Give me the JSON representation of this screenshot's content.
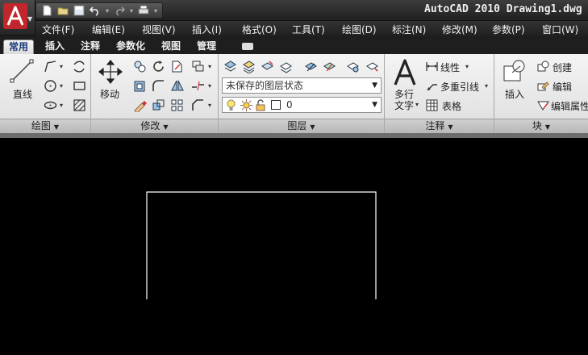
{
  "title_bar": {
    "text": "AutoCAD 2010  Drawing1.dwg"
  },
  "menu": [
    {
      "label": "文件(F)",
      "key": "file"
    },
    {
      "label": "编辑(E)",
      "key": "edit"
    },
    {
      "label": "视图(V)",
      "key": "view"
    },
    {
      "label": "插入(I)",
      "key": "insert"
    },
    {
      "label": "格式(O)",
      "key": "format"
    },
    {
      "label": "工具(T)",
      "key": "tools"
    },
    {
      "label": "绘图(D)",
      "key": "draw"
    },
    {
      "label": "标注(N)",
      "key": "dimension"
    },
    {
      "label": "修改(M)",
      "key": "modify"
    },
    {
      "label": "参数(P)",
      "key": "parametric"
    },
    {
      "label": "窗口(W)",
      "key": "window"
    }
  ],
  "tabs": [
    {
      "label": "常用",
      "active": true
    },
    {
      "label": "插入"
    },
    {
      "label": "注释"
    },
    {
      "label": "参数化"
    },
    {
      "label": "视图"
    },
    {
      "label": "管理"
    }
  ],
  "panels": {
    "draw": {
      "title": "绘图",
      "line_label": "直线"
    },
    "modify": {
      "title": "修改",
      "move_label": "移动"
    },
    "layers": {
      "title": "图层",
      "layer_state": "未保存的图层状态",
      "current_layer": "0"
    },
    "annotation": {
      "title": "注释",
      "multiline_text_1": "多行",
      "multiline_text_2": "文字",
      "linear": "线性",
      "multileader": "多重引线",
      "table": "表格"
    },
    "block": {
      "title": "块",
      "insert": "插入",
      "create": "创建",
      "edit": "编辑",
      "edit_attr": "编辑属性"
    }
  },
  "colors": {
    "canvas": "#000000",
    "accent": "#c0262c",
    "tab_active_text": "#1a3a7a"
  }
}
